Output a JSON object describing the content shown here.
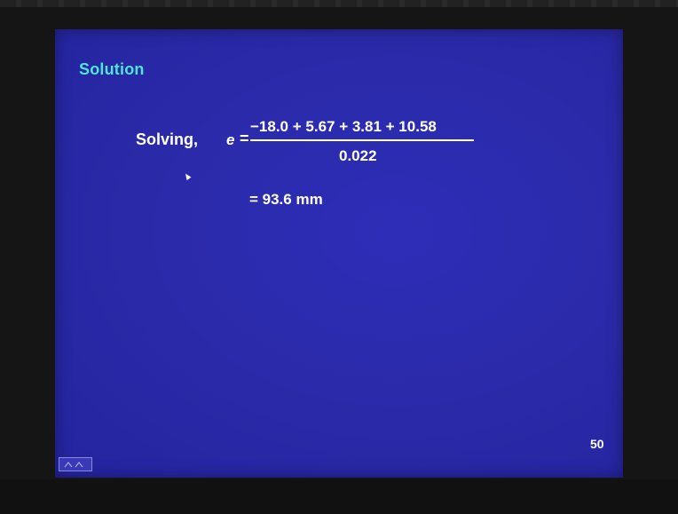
{
  "slide": {
    "heading": "Solution",
    "solving_label": "Solving,",
    "equation": {
      "variable": "e",
      "equals": "=",
      "numerator": "−18.0 + 5.67 + 3.81 + 10.58",
      "denominator": "0.022"
    },
    "result": "= 93.6 mm",
    "page_number": "50"
  },
  "colors": {
    "slide_background": "#2a2aa8",
    "heading": "#4fe6d6",
    "text": "#ffffff",
    "frame": "#151515"
  },
  "icons": {
    "pointer": "mouse-pointer-icon",
    "nav": "slide-navigation-icon"
  }
}
